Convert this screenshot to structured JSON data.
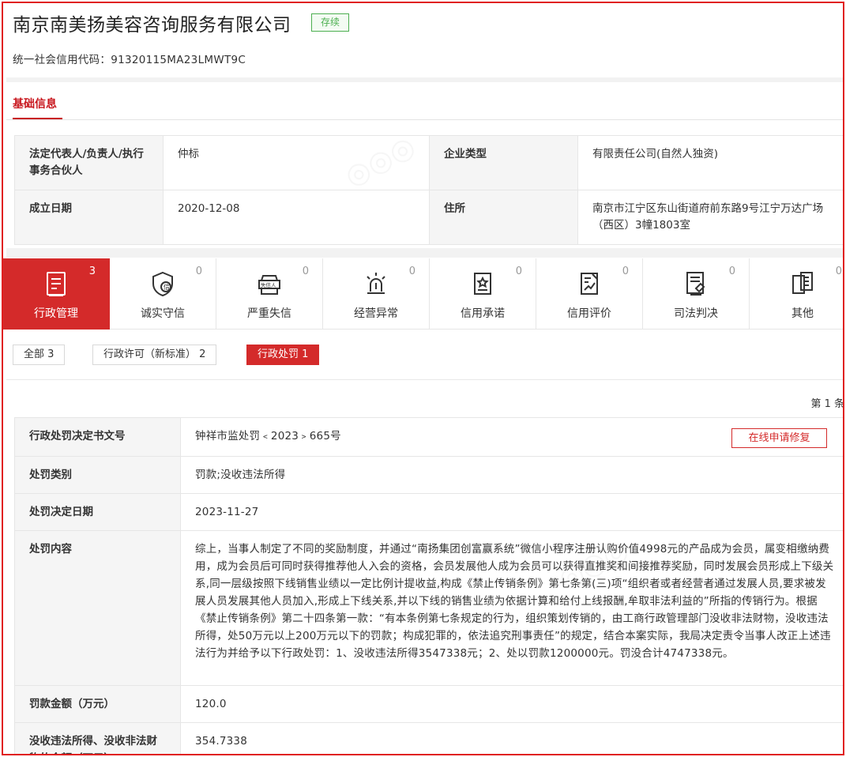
{
  "company": {
    "name": "南京南美扬美容咨询服务有限公司",
    "status": "存续",
    "credit_code": "统一社会信用代码：91320115MA23LMWT9C"
  },
  "basic_tab": "基础信息",
  "basic_info": {
    "legal_rep_label": "法定代表人/负责人/执行事务合伙人",
    "legal_rep_value": "仲标",
    "ent_type_label": "企业类型",
    "ent_type_value": "有限责任公司(自然人独资)",
    "found_date_label": "成立日期",
    "found_date_value": "2020-12-08",
    "address_label": "住所",
    "address_value": "南京市江宁区东山街道府前东路9号江宁万达广场（西区）3幢1803室"
  },
  "categories": [
    {
      "label": "行政管理",
      "count": "3",
      "icon": "document-list-icon"
    },
    {
      "label": "诚实守信",
      "count": "0",
      "icon": "shield-credit-icon"
    },
    {
      "label": "严重失信",
      "count": "0",
      "icon": "dishonest-person-icon"
    },
    {
      "label": "经营异常",
      "count": "0",
      "icon": "alarm-light-icon"
    },
    {
      "label": "信用承诺",
      "count": "0",
      "icon": "certificate-icon"
    },
    {
      "label": "信用评价",
      "count": "0",
      "icon": "evaluation-chart-icon"
    },
    {
      "label": "司法判决",
      "count": "0",
      "icon": "judgment-document-icon"
    },
    {
      "label": "其他",
      "count": "0",
      "icon": "other-document-icon"
    }
  ],
  "filters": [
    {
      "label": "全部  3"
    },
    {
      "label": "行政许可（新标准）  2"
    },
    {
      "label": "行政处罚  1"
    }
  ],
  "page_count": "第 1 条",
  "repair_button": "在线申请修复",
  "penalty": {
    "doc_no_label": "行政处罚决定书文号",
    "doc_no_value": "钟祥市监处罚﹤2023﹥665号",
    "category_label": "处罚类别",
    "category_value": "罚款;没收违法所得",
    "date_label": "处罚决定日期",
    "date_value": "2023-11-27",
    "content_label": "处罚内容",
    "content_value": "综上，当事人制定了不同的奖励制度，并通过“南扬集团创富赢系统”微信小程序注册认购价值4998元的产品成为会员，属变相缴纳费用，成为会员后可同时获得推荐他人入会的资格，会员发展他人成为会员可以获得直推奖和间接推荐奖励，同时发展会员形成上下级关系,同一层级按照下线销售业绩以一定比例计提收益,构成《禁止传销条例》第七条第(三)项“组织者或者经营者通过发展人员,要求被发展人员发展其他人员加入,形成上下线关系,并以下线的销售业绩为依据计算和给付上线报酬,牟取非法利益的”所指的传销行为。根据《禁止传销条例》第二十四条第一款：“有本条例第七条规定的行为，组织策划传销的，由工商行政管理部门没收非法财物，没收违法所得，处50万元以上200万元以下的罚款；构成犯罪的，依法追究刑事责任”的规定，结合本案实际，我局决定责令当事人改正上述违法行为并给予以下行政处罚：1、没收违法所得3547338元；2、处以罚款1200000元。罚没合计4747338元。",
    "fine_label": "罚款金额（万元）",
    "fine_value": "120.0",
    "confiscate_label": "没收违法所得、没收非法财物的金额（万元）",
    "confiscate_value": "354.7338"
  },
  "colors": {
    "brand_red": "#d42a2a",
    "status_green": "#4caf50",
    "label_bg": "#f5f5f5"
  }
}
